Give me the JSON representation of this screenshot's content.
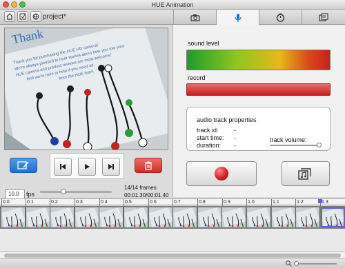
{
  "window": {
    "title": "HUE Animation"
  },
  "toolbar": {
    "project_name": "project*",
    "tabs": [
      {
        "icon": "camera-icon"
      },
      {
        "icon": "microphone-icon",
        "active": true
      },
      {
        "icon": "timer-icon"
      },
      {
        "icon": "export-icon"
      }
    ]
  },
  "audio": {
    "sound_level_label": "sound level",
    "record_label": "record",
    "props_title": "audio track properties",
    "track_id_label": "track id:",
    "track_id_value": "-",
    "start_time_label": "start time:",
    "start_time_value": "-",
    "duration_label": "duration:",
    "duration_value": "-",
    "track_volume_label": "track volume:",
    "track_volume_level": 1.0
  },
  "preview": {
    "paper_heading": "Thank",
    "paper_lines": [
      "Thank you for purchasing the HUE HD camera!",
      "We're always pleased to hear stories about how you use your",
      "HUE camera and product reviews are most welcome!",
      "And we're here to help if you need us.",
      "from the HUE team"
    ]
  },
  "playback": {
    "fps_value": "10.0",
    "fps_label": "fps",
    "frames_text": "14/14 frames",
    "time_text": "00:01.30/00:01.40",
    "speed_slider_level": 0.3
  },
  "timeline": {
    "ticks": [
      "0.0",
      "0.1",
      "0.2",
      "0.3",
      "0.4",
      "0.5",
      "0.6",
      "0.7",
      "0.8",
      "0.9",
      "1.0",
      "1.1",
      "1.2",
      "1.3"
    ],
    "frame_count": 14,
    "selected_frame_index": 13
  },
  "colors": {
    "accent": "#1b6fd8",
    "record_red": "#d21f1f",
    "delete_red": "#d63b32",
    "selection": "#5d64d8"
  }
}
